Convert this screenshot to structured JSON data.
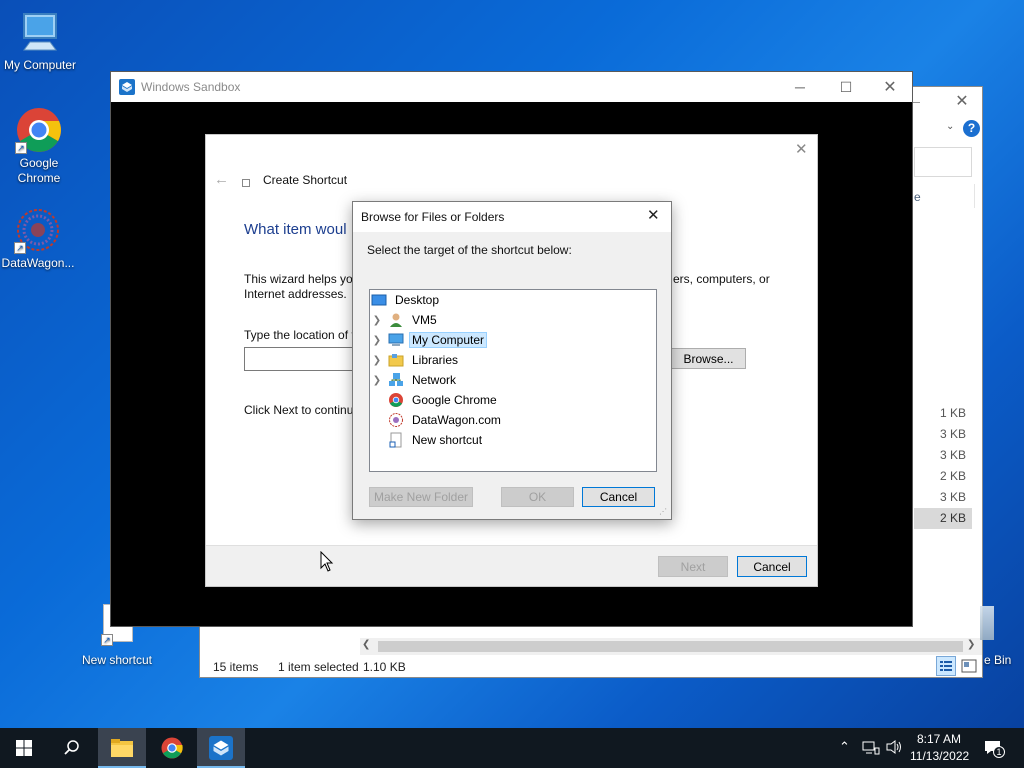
{
  "desktop": {
    "icons": [
      {
        "label": "My Computer"
      },
      {
        "label": "Google Chrome"
      },
      {
        "label": "DataWagon..."
      },
      {
        "label": "New shortcut"
      },
      {
        "label": "e Bin"
      }
    ]
  },
  "explorer": {
    "partial_text": "e",
    "file_sizes": [
      "1 KB",
      "3 KB",
      "3 KB",
      "2 KB",
      "3 KB",
      "2 KB"
    ],
    "status": {
      "items": "15 items",
      "selected": "1 item selected",
      "size": "1.10 KB"
    },
    "help_icon": "?"
  },
  "sandbox": {
    "title": "Windows Sandbox"
  },
  "wizard": {
    "header": "Create Shortcut",
    "heading": "What item woul",
    "desc_line1": "This wizard helps you",
    "desc_line1_right": "ers, computers, or",
    "desc_line2": "Internet addresses.",
    "location_label": "Type the location of t",
    "browse_label": "Browse...",
    "continue_text": "Click Next to continu",
    "next_label": "Next",
    "cancel_label": "Cancel"
  },
  "browse": {
    "title": "Browse for Files or Folders",
    "prompt": "Select the target of the shortcut below:",
    "tree": [
      {
        "label": "Desktop",
        "expandable": false,
        "icon": "desktop-folder-icon"
      },
      {
        "label": "VM5",
        "expandable": true,
        "icon": "user-icon"
      },
      {
        "label": "My Computer",
        "expandable": true,
        "icon": "computer-icon",
        "selected": true
      },
      {
        "label": "Libraries",
        "expandable": true,
        "icon": "libraries-icon"
      },
      {
        "label": "Network",
        "expandable": true,
        "icon": "network-icon"
      },
      {
        "label": "Google Chrome",
        "expandable": false,
        "icon": "chrome-icon"
      },
      {
        "label": "DataWagon.com",
        "expandable": false,
        "icon": "datawagon-icon"
      },
      {
        "label": "New shortcut",
        "expandable": false,
        "icon": "shortcut-file-icon"
      }
    ],
    "make_folder_label": "Make New Folder",
    "ok_label": "OK",
    "cancel_label": "Cancel"
  },
  "taskbar": {
    "time": "8:17 AM",
    "date": "11/13/2022",
    "notification_count": "1"
  },
  "colors": {
    "accent": "#0078d7",
    "selection": "#cce8ff",
    "taskbar": "#101820"
  }
}
